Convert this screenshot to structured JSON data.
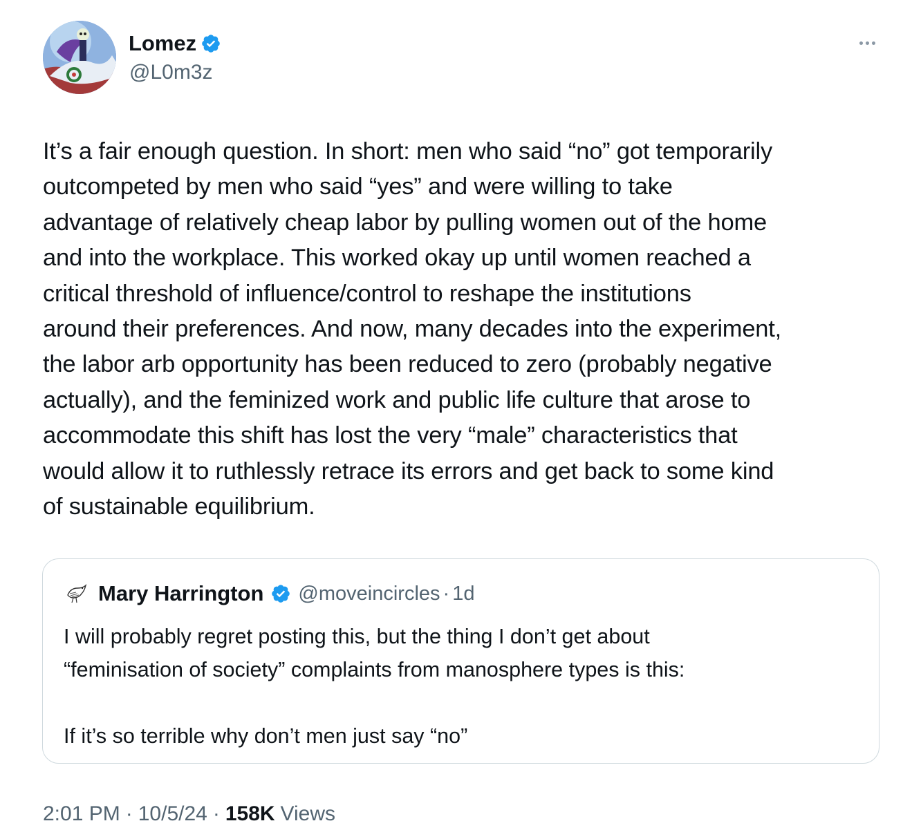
{
  "tweet": {
    "author": {
      "name": "Lomez",
      "handle": "@L0m3z",
      "verified": true
    },
    "text_lines": [
      "It’s a fair enough question. In short: men who said “no” got temporarily",
      "outcompeted by men who said “yes” and were willing to take",
      "advantage of relatively cheap labor by pulling women out of the home",
      "and into the workplace. This worked okay up until women reached a",
      "critical threshold of influence/control to reshape the institutions",
      "around their preferences. And now, many decades into the experiment,",
      "the labor arb opportunity has been reduced to zero (probably negative",
      "actually), and the feminized work and public life culture that arose to",
      "accommodate this shift has lost the very “male” characteristics that",
      "would allow it to ruthlessly retrace its errors and get back to some kind",
      "of sustainable equilibrium."
    ],
    "quoted": {
      "author_name": "Mary Harrington",
      "handle": "@moveincircles",
      "separator": "·",
      "age": "1d",
      "verified": true,
      "text_lines": [
        "I will probably regret posting this, but the thing I don’t get about",
        "“feminisation of society” complaints from manosphere types is this:",
        "",
        "If it’s so terrible why don’t men just say “no”"
      ]
    },
    "meta": {
      "time": "2:01 PM",
      "sep1": "·",
      "date": "10/5/24",
      "sep2": "·",
      "views_count": "158K",
      "views_label": "Views"
    }
  },
  "colors": {
    "verified_blue": "#1d9bf0",
    "secondary_text": "#536471",
    "border": "#cfd9de"
  },
  "icons": {
    "verified": "verified-badge-icon",
    "more": "more-horizontal-icon"
  }
}
